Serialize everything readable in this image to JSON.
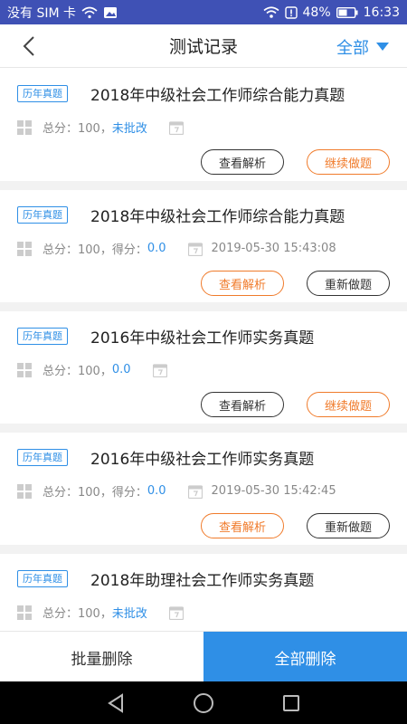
{
  "status_bar": {
    "carrier": "没有 SIM 卡",
    "battery": "48%",
    "time": "16:33"
  },
  "header": {
    "title": "测试记录",
    "filter_label": "全部"
  },
  "records": [
    {
      "tag": "历年真题",
      "title": "2018年中级社会工作师综合能力真题",
      "total": "总分：100，",
      "status_label": "",
      "status": "未批改",
      "date": "",
      "btn_left": "查看解析",
      "btn_right": "继续做题"
    },
    {
      "tag": "历年真题",
      "title": "2018年中级社会工作师综合能力真题",
      "total": "总分：100，",
      "status_label": "得分：",
      "status": "0.0",
      "date": "2019-05-30 15:43:08",
      "btn_left": "查看解析",
      "btn_right": "重新做题"
    },
    {
      "tag": "历年真题",
      "title": "2016年中级社会工作师实务真题",
      "total": "总分：100，",
      "status_label": "",
      "status": "0.0",
      "date": "",
      "btn_left": "查看解析",
      "btn_right": "继续做题"
    },
    {
      "tag": "历年真题",
      "title": "2016年中级社会工作师实务真题",
      "total": "总分：100，",
      "status_label": "得分：",
      "status": "0.0",
      "date": "2019-05-30 15:42:45",
      "btn_left": "查看解析",
      "btn_right": "重新做题"
    },
    {
      "tag": "历年真题",
      "title": "2018年助理社会工作师实务真题",
      "total": "总分：100，",
      "status_label": "",
      "status": "未批改",
      "date": ""
    }
  ],
  "bottom_bar": {
    "batch_delete": "批量删除",
    "delete_all": "全部删除"
  },
  "colors": {
    "accent": "#2f8fe6",
    "orange": "#f07b2b",
    "status_bar": "#3f51b5"
  }
}
